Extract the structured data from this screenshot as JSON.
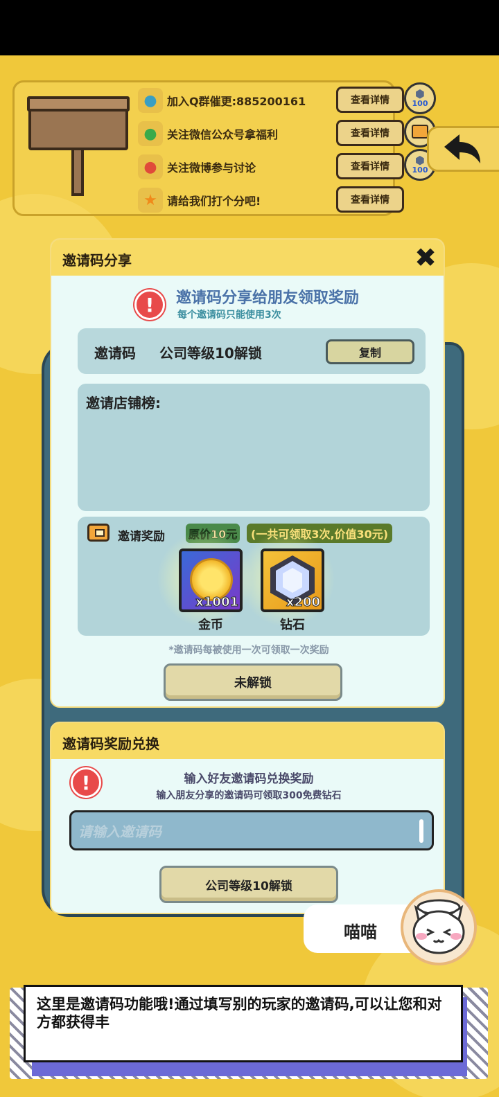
{
  "social": {
    "items": [
      {
        "label": "加入Q群催更:885200161",
        "button": "查看详情",
        "reward": "100",
        "icon": "qq-icon"
      },
      {
        "label": "关注微信公众号拿福利",
        "button": "查看详情",
        "reward": "",
        "icon": "wechat-icon"
      },
      {
        "label": "关注微博参与讨论",
        "button": "查看详情",
        "reward": "100",
        "icon": "weibo-icon"
      },
      {
        "label": "请给我们打个分吧!",
        "button": "查看详情",
        "reward": "",
        "icon": "star-icon"
      }
    ]
  },
  "invite_dialog": {
    "title": "邀请码分享",
    "close": "✖",
    "notice_title": "邀请码分享给朋友领取奖励",
    "notice_sub": "每个邀请码只能使用3次",
    "code_label": "邀请码",
    "code_value": "公司等级10解锁",
    "copy_button": "复制",
    "rank_title": "邀请店铺榜:",
    "reward_label": "邀请奖励",
    "price_tag": "原价10元",
    "price_extra": "(一共可领取3次,价值30元)",
    "items": [
      {
        "name": "金币",
        "count": "x1001"
      },
      {
        "name": "钻石",
        "count": "x200"
      }
    ],
    "footnote": "*邀请码每被使用一次可领取一次奖励",
    "unlock_button": "未解锁"
  },
  "redeem_dialog": {
    "title": "邀请码奖励兑换",
    "notice_title": "输入好友邀请码兑换奖励",
    "notice_sub": "输入朋友分享的邀请码可领取300免费钻石",
    "input_placeholder": "请输入邀请码",
    "button": "公司等级10解锁"
  },
  "cat_chat": {
    "speaker": "喵喵"
  },
  "tutorial": {
    "text": "这里是邀请码功能哦!通过填写别的玩家的邀请码,可以让您和对方都获得丰"
  },
  "colors": {
    "background": "#f0c83a",
    "dialog_header": "#f7da64",
    "dialog_body": "#eafaf8",
    "warning": "#e84a4a"
  }
}
